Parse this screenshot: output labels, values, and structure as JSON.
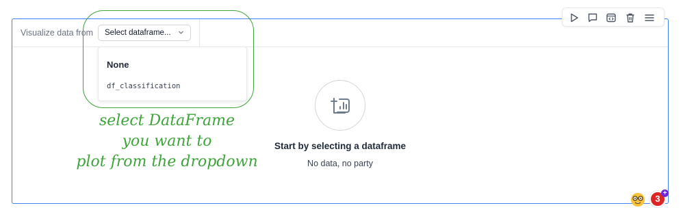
{
  "cell": {
    "header_label": "Visualize data from",
    "select_value": "Select dataframe..."
  },
  "dropdown": {
    "options": [
      "None",
      "df_classification"
    ]
  },
  "empty_state": {
    "title": "Start by selecting a dataframe",
    "subtitle": "No data, no party",
    "icon": "chart-add-icon"
  },
  "toolbar": {
    "icons": [
      "play-icon",
      "comment-icon",
      "code-icon",
      "trash-icon",
      "menu-icon"
    ]
  },
  "annotation": {
    "lines": [
      "select DataFrame",
      "you want to",
      "plot from the dropdown"
    ],
    "color": "#3ea43a"
  },
  "notifications": {
    "count": "3"
  },
  "colors": {
    "accent": "#3b82f6",
    "badge": "#dc2626",
    "annotation": "#3ea43a"
  }
}
